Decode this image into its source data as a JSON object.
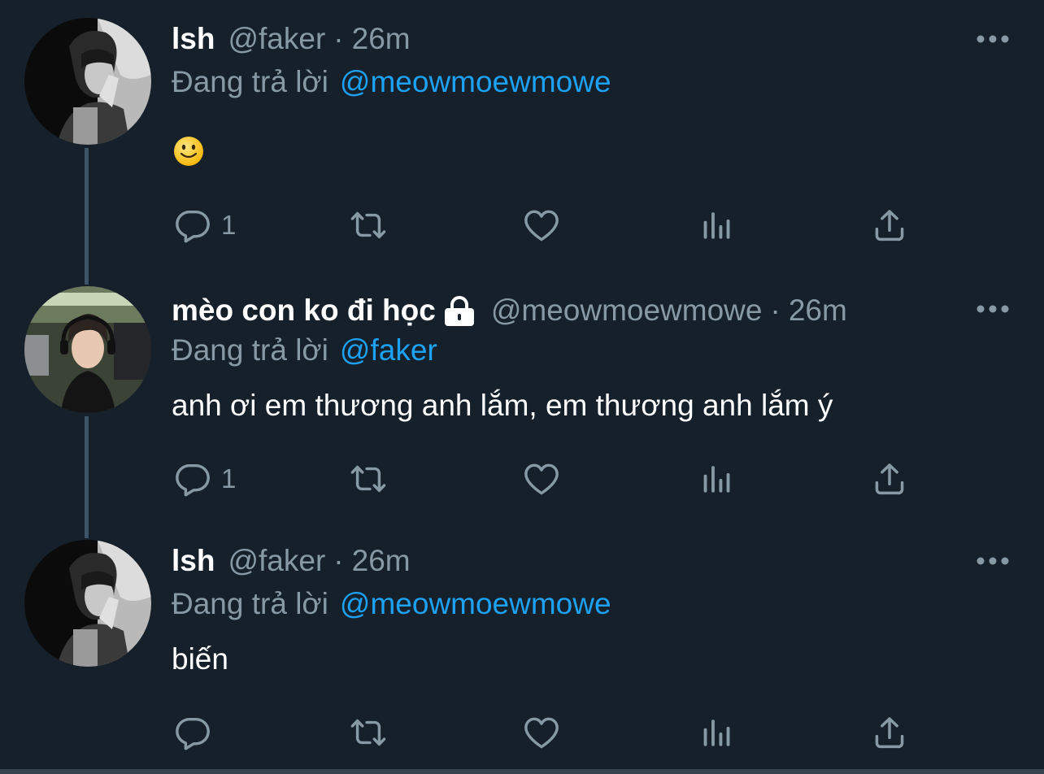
{
  "tweets": [
    {
      "name": "lsh",
      "handle": "@faker",
      "separator": "·",
      "time": "26m",
      "replying_label": "Đang trả lời",
      "replying_to": "@meowmoewmowe",
      "text": "",
      "emoji": "slightly-smiling-face",
      "reply_count": "1",
      "avatar_icon": "bw-portrait"
    },
    {
      "name": "mèo con ko đi học",
      "protected_icon": "lock-icon",
      "handle": "@meowmoewmowe",
      "separator": "·",
      "time": "26m",
      "replying_label": "Đang trả lời",
      "replying_to": "@faker",
      "text": "anh ơi em thương anh lắm, em thương anh lắm ý",
      "reply_count": "1",
      "avatar_icon": "color-portrait"
    },
    {
      "name": "lsh",
      "handle": "@faker",
      "separator": "·",
      "time": "26m",
      "replying_label": "Đang trả lời",
      "replying_to": "@meowmoewmowe",
      "text": "biến",
      "reply_count": "",
      "avatar_icon": "bw-portrait"
    }
  ],
  "colors": {
    "background": "#15202b",
    "text_primary": "#ffffff",
    "text_secondary": "#8899a6",
    "accent": "#1da1f2",
    "thread_line": "#3d5466"
  },
  "action_icons": [
    "reply-icon",
    "retweet-icon",
    "like-icon",
    "analytics-icon",
    "share-icon"
  ]
}
